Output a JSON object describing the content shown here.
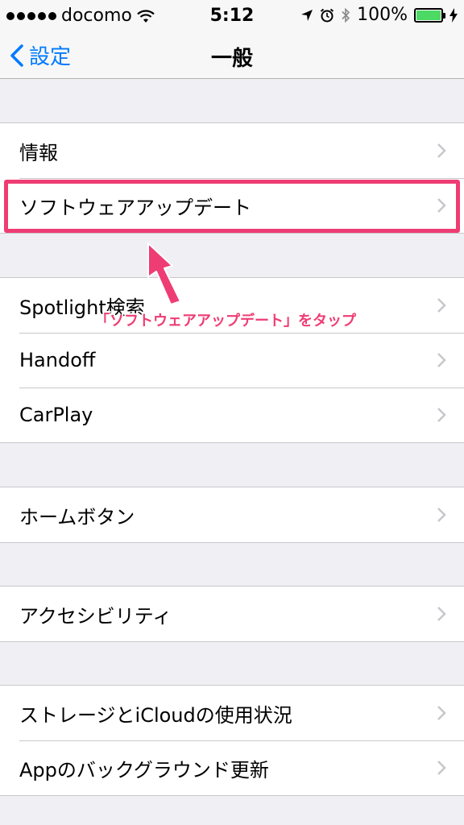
{
  "status_bar": {
    "carrier": "docomo",
    "time": "5:12",
    "battery": "100%",
    "battery_level": 1.0
  },
  "nav": {
    "back_label": "設定",
    "title": "一般"
  },
  "groups": [
    {
      "items": [
        "情報",
        "ソフトウェアアップデート"
      ]
    },
    {
      "items": [
        "Spotlight検索",
        "Handoff",
        "CarPlay"
      ]
    },
    {
      "items": [
        "ホームボタン"
      ]
    },
    {
      "items": [
        "アクセシビリティ"
      ]
    },
    {
      "items": [
        "ストレージとiCloudの使用状況",
        "Appのバックグラウンド更新"
      ]
    }
  ],
  "annotation": {
    "text": "「ソフトウェアアップデート」をタップ",
    "color": "#ee3d74"
  },
  "colors": {
    "accent": "#007aff",
    "battery_green": "#4cd964",
    "background": "#efeff4"
  }
}
